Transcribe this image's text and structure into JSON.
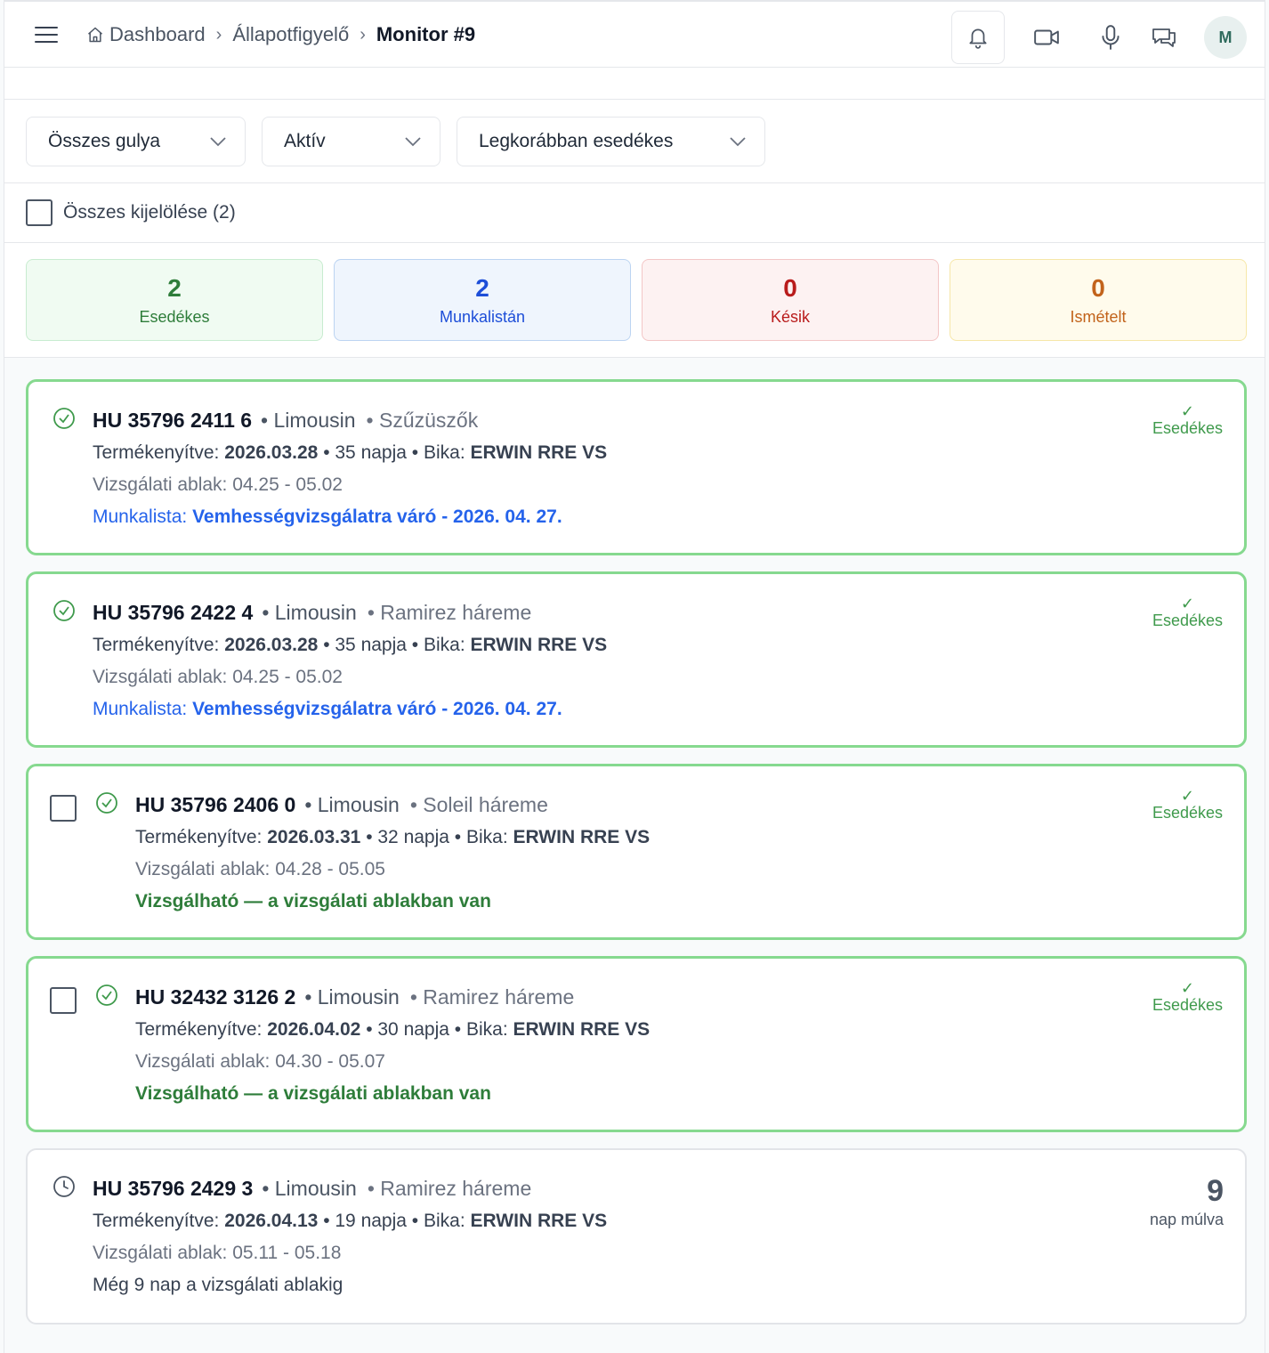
{
  "header": {
    "breadcrumb": [
      {
        "label": "Dashboard"
      },
      {
        "label": "Állapotfigyelő"
      },
      {
        "label": "Monitor #9"
      }
    ],
    "avatar_initial": "M"
  },
  "filters": [
    {
      "value": "Összes gulya"
    },
    {
      "value": "Aktív"
    },
    {
      "value": "Legkorábban esedékes"
    }
  ],
  "select_all_label": "Összes kijelölése (2)",
  "stats": [
    {
      "value": "2",
      "label": "Esedékes",
      "color": "#2e7d3a"
    },
    {
      "value": "2",
      "label": "Munkalistán",
      "color": "#1d4ed8"
    },
    {
      "value": "0",
      "label": "Késik",
      "color": "#b91c1c"
    },
    {
      "value": "0",
      "label": "Ismételt",
      "color": "#c2631b"
    }
  ],
  "cards": [
    {
      "id": "HU 35796 2411 6",
      "breed": "• Limousin",
      "group": "• Szűzüszők",
      "insem_label": "Termékenyítve:",
      "insem_date": "2026.03.28",
      "days": "• 35 napja • Bika:",
      "bull": "ERWIN RRE VS",
      "window": "Vizsgálati ablak: 04.25 - 05.02",
      "note_prefix": "Munkalista:",
      "note": "Vemhességvizsgálatra váró - 2026. 04. 27.",
      "badge": "Esedékes",
      "status_icon": "check-circle-icon"
    },
    {
      "id": "HU 35796 2422 4",
      "breed": "• Limousin",
      "group": "• Ramirez háreme",
      "insem_label": "Termékenyítve:",
      "insem_date": "2026.03.28",
      "days": "• 35 napja • Bika:",
      "bull": "ERWIN RRE VS",
      "window": "Vizsgálati ablak: 04.25 - 05.02",
      "note_prefix": "Munkalista:",
      "note": "Vemhességvizsgálatra váró - 2026. 04. 27.",
      "badge": "Esedékes",
      "status_icon": "check-circle-icon"
    },
    {
      "id": "HU 35796 2406 0",
      "breed": "• Limousin",
      "group": "• Soleil háreme",
      "insem_label": "Termékenyítve:",
      "insem_date": "2026.03.31",
      "days": "• 32 napja • Bika:",
      "bull": "ERWIN RRE VS",
      "window": "Vizsgálati ablak: 04.28 - 05.05",
      "note": "Vizsgálható — a vizsgálati ablakban van",
      "badge": "Esedékes",
      "status_icon": "check-circle-icon"
    },
    {
      "id": "HU 32432 3126 2",
      "breed": "• Limousin",
      "group": "• Ramirez háreme",
      "insem_label": "Termékenyítve:",
      "insem_date": "2026.04.02",
      "days": "• 30 napja • Bika:",
      "bull": "ERWIN RRE VS",
      "window": "Vizsgálati ablak: 04.30 - 05.07",
      "note": "Vizsgálható — a vizsgálati ablakban van",
      "badge": "Esedékes",
      "status_icon": "check-circle-icon"
    },
    {
      "id": "HU 35796 2429 3",
      "breed": "• Limousin",
      "group": "• Ramirez háreme",
      "insem_label": "Termékenyítve:",
      "insem_date": "2026.04.13",
      "days": "• 19 napja • Bika:",
      "bull": "ERWIN RRE VS",
      "window": "Vizsgálati ablak: 05.11 - 05.18",
      "note": "Még 9 nap a vizsgálati ablakig",
      "countdown_value": "9",
      "countdown_label": "nap múlva",
      "status_icon": "clock-icon"
    }
  ]
}
